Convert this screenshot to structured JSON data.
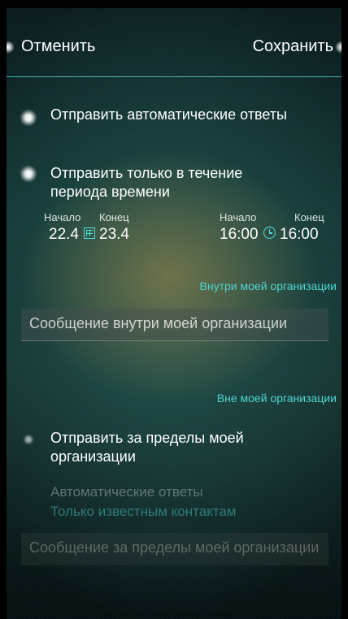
{
  "topbar": {
    "cancel": "Отменить",
    "save": "Сохранить"
  },
  "options": {
    "auto_reply": "Отправить автоматические ответы",
    "time_period": "Отправить только в течение периода времени",
    "outside_org": "Отправить за пределы моей организации"
  },
  "schedule": {
    "date_start_label": "Начало",
    "date_end_label": "Конец",
    "date_start": "22.4",
    "date_end": "23.4",
    "time_start_label": "Начало",
    "time_end_label": "Конец",
    "time_start": "16:00",
    "time_end": "16:00",
    "calendar_icon": "calendar-icon",
    "clock_icon": "clock-icon"
  },
  "inside": {
    "header": "Внутри моей организации",
    "placeholder": "Сообщение внутри моей организации"
  },
  "outside": {
    "header": "Вне моей организации",
    "auto_replies_label": "Автоматические ответы",
    "audience_value": "Только известным контактам",
    "placeholder": "Сообщение за пределы моей организации"
  },
  "colors": {
    "accent": "#4fd6d2",
    "divider": "#5fd1cf"
  }
}
